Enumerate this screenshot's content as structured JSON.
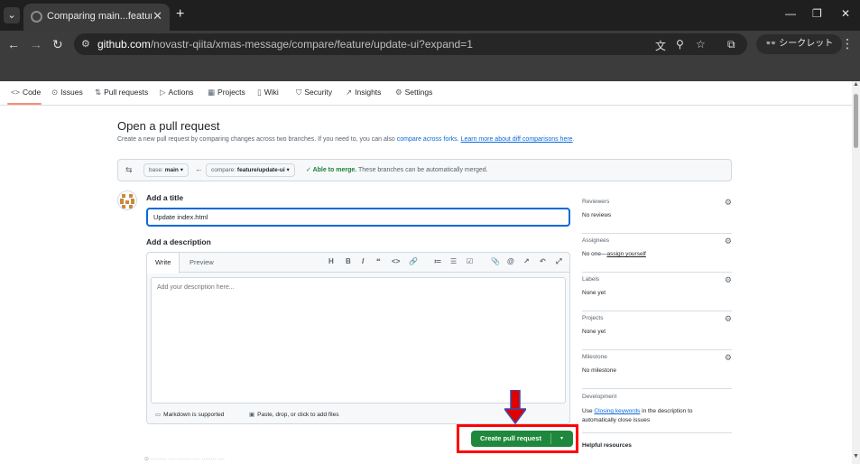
{
  "browser": {
    "tab_title": "Comparing main...feature/update-ui",
    "tab_close": "✕",
    "new_tab": "+",
    "url_host": "github.com",
    "url_path": "/novastr-qiita/xmas-message/compare/feature/update-ui?expand=1",
    "incognito_label": "シークレット",
    "controls": {
      "minimize": "—",
      "restore": "❐",
      "close": "✕"
    },
    "nav": {
      "back": "←",
      "forward": "→",
      "reload": "↻"
    }
  },
  "repo_nav": {
    "items": [
      {
        "label": "Code",
        "icon": "code-icon"
      },
      {
        "label": "Issues",
        "icon": "issue-icon"
      },
      {
        "label": "Pull requests",
        "icon": "pull-request-icon"
      },
      {
        "label": "Actions",
        "icon": "play-icon"
      },
      {
        "label": "Projects",
        "icon": "table-icon"
      },
      {
        "label": "Wiki",
        "icon": "book-icon"
      },
      {
        "label": "Security",
        "icon": "shield-icon"
      },
      {
        "label": "Insights",
        "icon": "graph-icon"
      },
      {
        "label": "Settings",
        "icon": "gear-icon"
      }
    ],
    "active": "Code"
  },
  "page": {
    "title": "Open a pull request",
    "subtitle_text": "Create a new pull request by comparing changes across two branches. If you need to, you can also",
    "compare_forks_link": "compare across forks.",
    "learn_more_link": "Learn more about diff comparisons here"
  },
  "compare": {
    "base_key": "base:",
    "base_value": "main",
    "compare_key": "compare:",
    "compare_value": "feature/update-ui",
    "merge_status": "Able to merge.",
    "merge_detail": "These branches can be automatically merged."
  },
  "form": {
    "title_label": "Add a title",
    "title_value": "Update index.html",
    "description_label": "Add a description",
    "write_tab": "Write",
    "preview_tab": "Preview",
    "description_placeholder": "Add your description here...",
    "markdown_note": "Markdown is supported",
    "attach_note": "Paste, drop, or click to add files",
    "toolbar": [
      "H",
      "B",
      "I",
      "❝",
      "<>",
      "🔗",
      "≔",
      "☰",
      "☑",
      "📎",
      "@",
      "↗",
      "↶",
      "⤢"
    ]
  },
  "sidebar": {
    "reviewers": {
      "head": "Reviewers",
      "value": "No reviews"
    },
    "assignees": {
      "head": "Assignees",
      "value_prefix": "No one—",
      "value_link": "assign yourself"
    },
    "labels": {
      "head": "Labels",
      "value": "None yet"
    },
    "projects": {
      "head": "Projects",
      "value": "None yet"
    },
    "milestone": {
      "head": "Milestone",
      "value": "No milestone"
    },
    "development": {
      "head": "Development",
      "text_before": "Use",
      "link": "Closing keywords",
      "text_after": "in the description to automatically close issues"
    },
    "helpful": "Helpful resources"
  },
  "actions": {
    "create_label": "Create pull request",
    "dropdown": "▾"
  },
  "colors": {
    "accent": "#0969da",
    "create_green": "#1f883d",
    "highlight_red": "#ff0000",
    "merge_ok": "#1a7f37"
  }
}
